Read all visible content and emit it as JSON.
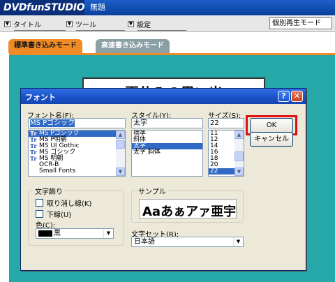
{
  "app": {
    "name": "DVDfunSTUDIO",
    "document_title": "無題"
  },
  "menu": {
    "items": [
      "タイトル",
      "ツール",
      "設定"
    ],
    "playback_mode": "個別再生モード"
  },
  "mode_tabs": {
    "standard": "標準書き込みモード",
    "fast": "高速書き込みモード"
  },
  "canvas": {
    "title_text": "夏休みの思い出"
  },
  "font_dialog": {
    "title": "フォント",
    "help_glyph": "?",
    "close_glyph": "✕",
    "font_name_label": "フォント名(F):",
    "font_name_value": "MS Pゴシック",
    "font_list": [
      {
        "name": "MS Pゴシック",
        "selected": true
      },
      {
        "name": "MS P明朝",
        "selected": false
      },
      {
        "name": "MS UI Gothic",
        "selected": false
      },
      {
        "name": "MS ゴシック",
        "selected": false
      },
      {
        "name": "MS 明朝",
        "selected": false
      },
      {
        "name": "OCR-B",
        "selected": false
      },
      {
        "name": "Small Fonts",
        "selected": false
      }
    ],
    "style_label": "スタイル(Y):",
    "style_value": "太字",
    "style_list": [
      {
        "name": "標準",
        "selected": false
      },
      {
        "name": "斜体",
        "selected": false
      },
      {
        "name": "太字",
        "selected": true
      },
      {
        "name": "太字 斜体",
        "selected": false
      }
    ],
    "size_label": "サイズ(S):",
    "size_value": "22",
    "size_list": [
      {
        "name": "11",
        "selected": false
      },
      {
        "name": "12",
        "selected": false
      },
      {
        "name": "14",
        "selected": false
      },
      {
        "name": "16",
        "selected": false
      },
      {
        "name": "18",
        "selected": false
      },
      {
        "name": "20",
        "selected": false
      },
      {
        "name": "22",
        "selected": true
      }
    ],
    "ok_label": "OK",
    "cancel_label": "キャンセル",
    "effects_label": "文字飾り",
    "strikeout_label": "取り消し線(K)",
    "underline_label": "下線(U)",
    "color_label": "色(C):",
    "color_value": "黒",
    "sample_label": "サンプル",
    "sample_text": "Aaあぁアァ亜宇",
    "charset_label": "文字セット(R):",
    "charset_value": "日本語"
  },
  "colors": {
    "title_bar": "#1c5fc7",
    "active_tab": "#f08a24",
    "canvas_bg": "#27a8a8",
    "selection": "#316ac5",
    "highlight_box": "#e01010"
  }
}
